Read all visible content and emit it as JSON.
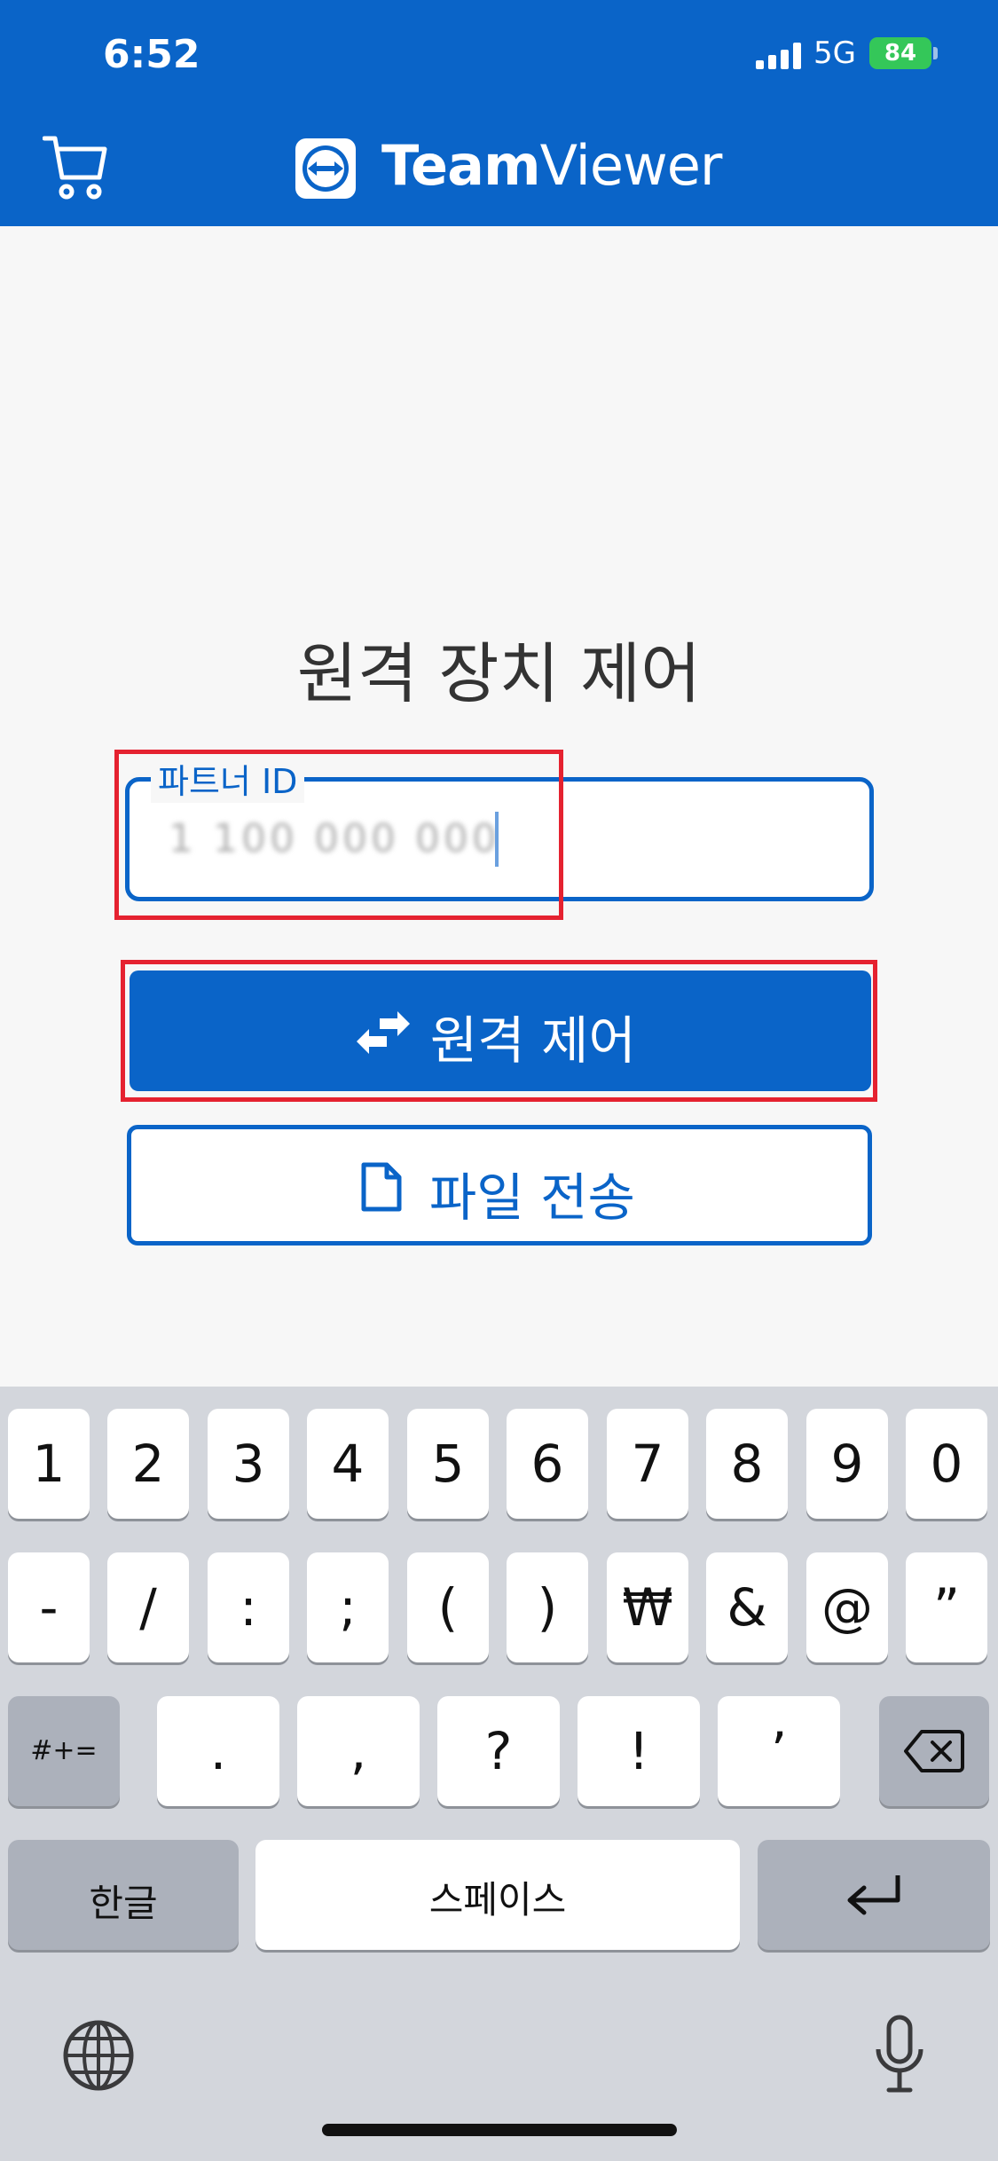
{
  "status_bar": {
    "time": "6:52",
    "network": "5G",
    "battery": "84"
  },
  "header": {
    "brand_bold": "Team",
    "brand_light": "Viewer"
  },
  "main": {
    "title": "원격 장치 제어",
    "partner_field": {
      "label": "파트너 ID",
      "value": "1 100 000 000"
    },
    "remote_control_button": "원격 제어",
    "file_transfer_button": "파일 전송"
  },
  "keyboard": {
    "row1": [
      "1",
      "2",
      "3",
      "4",
      "5",
      "6",
      "7",
      "8",
      "9",
      "0"
    ],
    "row2": [
      "-",
      "/",
      ":",
      ";",
      "(",
      ")",
      "₩",
      "&",
      "@",
      "”"
    ],
    "row3": [
      ".",
      ",",
      "?",
      "!",
      "’"
    ],
    "symbols_key": "#+=",
    "korean_key": "한글",
    "space_key": "스페이스"
  },
  "colors": {
    "brand_blue": "#0a64c8",
    "highlight_red": "#e52230"
  },
  "icons": [
    "cart-icon",
    "teamviewer-logo-icon",
    "swap-arrows-icon",
    "file-icon",
    "backspace-icon",
    "return-icon",
    "globe-icon",
    "microphone-icon"
  ]
}
